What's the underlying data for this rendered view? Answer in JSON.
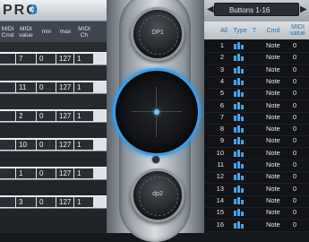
{
  "app": {
    "name": "PRO",
    "version": "3"
  },
  "left_table": {
    "headers": [
      "MIDI Cmd",
      "MIDI value",
      "min",
      "max",
      "MIDI Ch"
    ],
    "rows": [
      {
        "cmd": "",
        "value": "7",
        "min": "0",
        "max": "127",
        "channel": "1"
      },
      {
        "cmd": "",
        "value": "11",
        "min": "0",
        "max": "127",
        "channel": "1"
      },
      {
        "cmd": "",
        "value": "2",
        "min": "0",
        "max": "127",
        "channel": "1"
      },
      {
        "cmd": "",
        "value": "10",
        "min": "0",
        "max": "127",
        "channel": "1"
      },
      {
        "cmd": "",
        "value": "1",
        "min": "0",
        "max": "127",
        "channel": "1"
      },
      {
        "cmd": "",
        "value": "3",
        "min": "0",
        "max": "127",
        "channel": "1"
      }
    ]
  },
  "center": {
    "top_knob_label": "DP1",
    "bottom_knob_label": "dp2"
  },
  "right_panel": {
    "bank_selector": "Buttons 1-16",
    "prev_icon": "arrow-left-icon",
    "next_icon": "arrow-right-icon",
    "headers": [
      "All",
      "Type",
      "T",
      "Cmd",
      "MIDI value"
    ],
    "rows": [
      {
        "num": "1",
        "type": "gate-icon",
        "cmd": "Note",
        "value": "0"
      },
      {
        "num": "2",
        "type": "gate-icon",
        "cmd": "Note",
        "value": "0"
      },
      {
        "num": "3",
        "type": "gate-icon",
        "cmd": "Note",
        "value": "0"
      },
      {
        "num": "4",
        "type": "gate-icon",
        "cmd": "Note",
        "value": "0"
      },
      {
        "num": "5",
        "type": "gate-icon",
        "cmd": "Note",
        "value": "0"
      },
      {
        "num": "6",
        "type": "gate-icon",
        "cmd": "Note",
        "value": "0"
      },
      {
        "num": "7",
        "type": "gate-icon",
        "cmd": "Note",
        "value": "0"
      },
      {
        "num": "8",
        "type": "gate-icon",
        "cmd": "Note",
        "value": "0"
      },
      {
        "num": "9",
        "type": "gate-icon",
        "cmd": "Note",
        "value": "0"
      },
      {
        "num": "10",
        "type": "gate-icon",
        "cmd": "Note",
        "value": "0"
      },
      {
        "num": "11",
        "type": "gate-icon",
        "cmd": "Note",
        "value": "0"
      },
      {
        "num": "12",
        "type": "gate-icon",
        "cmd": "Note",
        "value": "0"
      },
      {
        "num": "13",
        "type": "gate-icon",
        "cmd": "Note",
        "value": "0"
      },
      {
        "num": "14",
        "type": "gate-icon",
        "cmd": "Note",
        "value": "0"
      },
      {
        "num": "15",
        "type": "gate-icon",
        "cmd": "Note",
        "value": "0"
      },
      {
        "num": "16",
        "type": "gate-icon",
        "cmd": "Note",
        "value": "0"
      }
    ]
  },
  "colors": {
    "accent": "#2b8ed8",
    "pad_ring": "#3a9ee8",
    "icon_blue": "#4aa3e8"
  }
}
